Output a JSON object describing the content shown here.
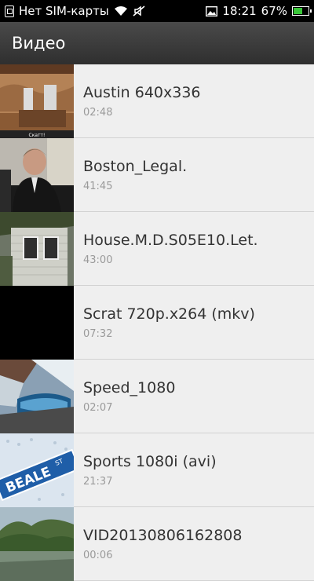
{
  "status_bar": {
    "carrier": "Нет SIM-карты",
    "time": "18:21",
    "battery": "67%",
    "battery_level": 0.67,
    "icons": [
      "sim-icon",
      "wifi-icon",
      "mute-icon",
      "image-icon",
      "battery-icon"
    ]
  },
  "header": {
    "title": "Видео"
  },
  "videos": [
    {
      "title": "Austin 640x336",
      "duration": "02:48",
      "thumb_caption": "Скатт!"
    },
    {
      "title": "Boston_Legal.",
      "duration": "41:45"
    },
    {
      "title": "House.M.D.S05E10.Let.",
      "duration": "43:00"
    },
    {
      "title": "Scrat 720p.x264 (mkv)",
      "duration": "07:32"
    },
    {
      "title": "Speed_1080",
      "duration": "02:07"
    },
    {
      "title": "Sports 1080i (avi)",
      "duration": "21:37",
      "thumb_sign": "BEALE",
      "thumb_sign_suffix": "ST"
    },
    {
      "title": "VID20130806162808",
      "duration": "00:06"
    }
  ]
}
